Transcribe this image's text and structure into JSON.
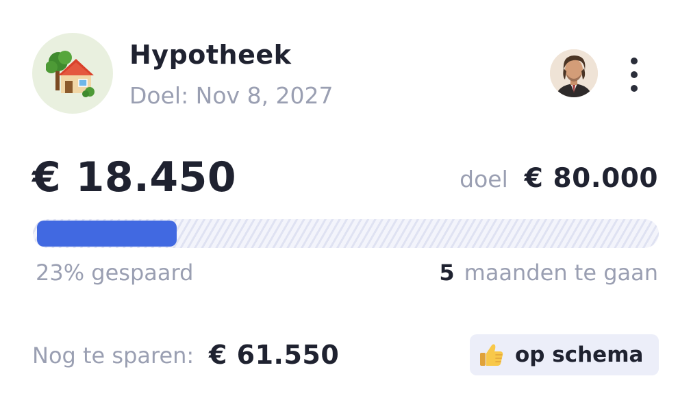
{
  "goal": {
    "icon": "house-with-garden-icon",
    "title": "Hypotheek",
    "date": "Doel: Nov 8, 2027"
  },
  "header": {
    "avatar": "user-avatar",
    "more_icon": "more-vertical-icon"
  },
  "amounts": {
    "saved": "€ 18.450",
    "target_label": "doel",
    "target": "€ 80.000"
  },
  "progress": {
    "fraction": 0.23,
    "percent_text": "23% gespaard",
    "months_count": "5",
    "months_text": "maanden te gaan"
  },
  "remaining": {
    "label": "Nog te sparen:",
    "amount": "€ 61.550"
  },
  "status": {
    "icon": "thumbs-up-icon",
    "label": "op schema"
  },
  "colors": {
    "accent": "#4169e1",
    "text_dark": "#1f2230",
    "text_muted": "#9a9fb2",
    "badge_bg": "#eceef9",
    "icon_bg": "#e9f0df"
  }
}
